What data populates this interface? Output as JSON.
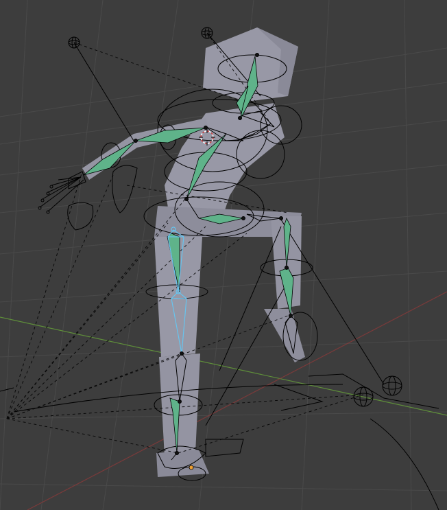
{
  "viewport": {
    "view": "3d-viewport",
    "mode": "pose-mode",
    "colors": {
      "background": "#3d3d3d",
      "grid": "#4a4a4a",
      "x_axis": "#8a3a3a",
      "y_axis": "#5f8f3a",
      "mesh": "#9898a6",
      "mesh_shade": "#7c7c8a",
      "bone_posed": "#5fb38a",
      "bone_selected": "#67c4ee",
      "wire": "#000000",
      "cursor_red": "#d23c3c",
      "origin": "#f0a030"
    }
  }
}
